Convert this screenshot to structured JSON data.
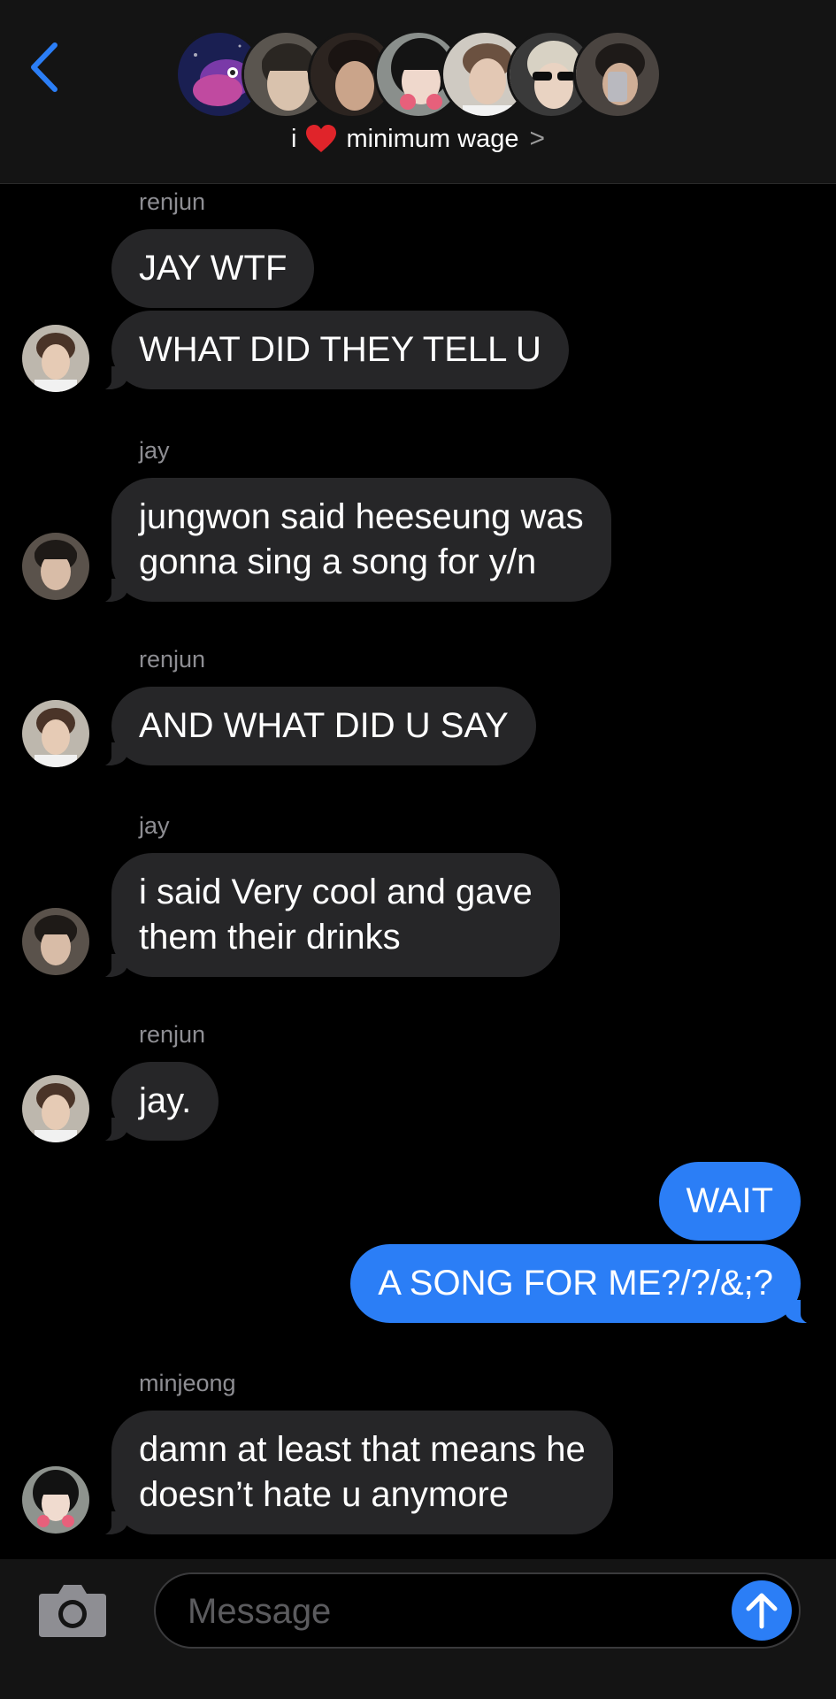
{
  "header": {
    "group_prefix": "i",
    "group_emoji": "heart",
    "group_suffix": "minimum wage",
    "chevron": ">",
    "back_icon": "chevron-left-icon"
  },
  "colors": {
    "accent": "#2b7ef6",
    "incoming_bubble": "#262628",
    "background": "#000000",
    "header_bg": "#141414"
  },
  "messages": {
    "renjun_1": {
      "sender": "renjun",
      "text1": "JAY WTF",
      "text2": "WHAT DID THEY TELL U"
    },
    "jay_1": {
      "sender": "jay",
      "text": "jungwon said heeseung was\ngonna sing a song for y/n"
    },
    "renjun_2": {
      "sender": "renjun",
      "text": "AND WHAT DID U SAY"
    },
    "jay_2": {
      "sender": "jay",
      "text": "i said Very cool and gave\nthem their drinks"
    },
    "renjun_3": {
      "sender": "renjun",
      "text": "jay."
    },
    "me": {
      "text1": "WAIT",
      "text2": "A SONG FOR ME?/?/&;?"
    },
    "minjeong_1": {
      "sender": "minjeong",
      "text": "damn at least that means he\ndoesn’t hate u anymore"
    }
  },
  "composer": {
    "placeholder": "Message",
    "camera_icon": "camera-icon",
    "send_icon": "arrow-up-icon"
  }
}
